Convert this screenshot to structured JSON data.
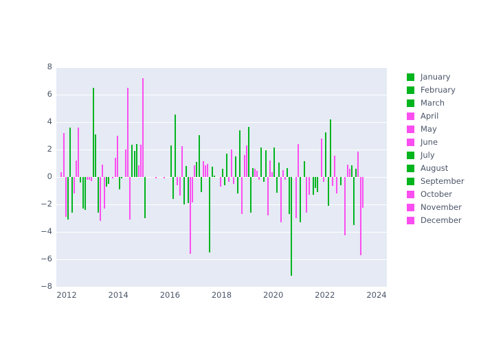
{
  "chart_data": {
    "type": "bar",
    "title": "",
    "subtitle": "",
    "xlabel": "",
    "ylabel": "",
    "xlim": [
      2011.6,
      2024.4
    ],
    "ylim": [
      -8,
      8
    ],
    "grid": true,
    "legend_position": "right",
    "colors": {
      "green": "#00b41e",
      "magenta": "#fb4ef0",
      "plot_background": "#e5eaf4",
      "gridline": "#ffffff",
      "tick_text": "#4a5568",
      "figure_background": "#ffffff"
    },
    "yticks": [
      -8,
      -6,
      -4,
      -2,
      0,
      2,
      4,
      6,
      8
    ],
    "ytick_labels": [
      "−8",
      "−6",
      "−4",
      "−2",
      "0",
      "2",
      "4",
      "6",
      "8"
    ],
    "xticks": [
      2012,
      2014,
      2016,
      2018,
      2020,
      2022,
      2024
    ],
    "xtick_labels": [
      "2012",
      "2014",
      "2016",
      "2018",
      "2020",
      "2022",
      "2024"
    ],
    "legend": [
      {
        "label": "January",
        "color": "#00b41e"
      },
      {
        "label": "February",
        "color": "#00b41e"
      },
      {
        "label": "March",
        "color": "#00b41e"
      },
      {
        "label": "April",
        "color": "#fb4ef0"
      },
      {
        "label": "May",
        "color": "#fb4ef0"
      },
      {
        "label": "June",
        "color": "#fb4ef0"
      },
      {
        "label": "July",
        "color": "#00b41e"
      },
      {
        "label": "August",
        "color": "#00b41e"
      },
      {
        "label": "September",
        "color": "#00b41e"
      },
      {
        "label": "October",
        "color": "#fb4ef0"
      },
      {
        "label": "November",
        "color": "#fb4ef0"
      },
      {
        "label": "December",
        "color": "#fb4ef0"
      }
    ],
    "x": [
      2011.79,
      2011.88,
      2011.96,
      2012.04,
      2012.13,
      2012.21,
      2012.29,
      2012.38,
      2012.46,
      2012.54,
      2012.63,
      2012.71,
      2012.79,
      2012.88,
      2012.96,
      2013.04,
      2013.13,
      2013.21,
      2013.29,
      2013.38,
      2013.46,
      2013.54,
      2013.63,
      2013.71,
      2013.79,
      2013.88,
      2013.96,
      2014.04,
      2014.13,
      2014.21,
      2014.29,
      2014.38,
      2014.46,
      2014.54,
      2014.63,
      2014.71,
      2014.79,
      2014.88,
      2014.96,
      2015.04,
      2015.13,
      2015.21,
      2015.29,
      2015.38,
      2015.46,
      2015.54,
      2015.63,
      2015.71,
      2015.79,
      2015.88,
      2015.96,
      2016.04,
      2016.13,
      2016.21,
      2016.29,
      2016.38,
      2016.46,
      2016.54,
      2016.63,
      2016.71,
      2016.79,
      2016.88,
      2016.96,
      2017.04,
      2017.13,
      2017.21,
      2017.29,
      2017.38,
      2017.46,
      2017.54,
      2017.63,
      2017.71,
      2017.79,
      2017.88,
      2017.96,
      2018.04,
      2018.13,
      2018.21,
      2018.29,
      2018.38,
      2018.46,
      2018.54,
      2018.63,
      2018.71,
      2018.79,
      2018.88,
      2018.96,
      2019.04,
      2019.13,
      2019.21,
      2019.29,
      2019.38,
      2019.46,
      2019.54,
      2019.63,
      2019.71,
      2019.79,
      2019.88,
      2019.96,
      2020.04,
      2020.13,
      2020.21,
      2020.29,
      2020.38,
      2020.46,
      2020.54,
      2020.63,
      2020.71,
      2020.79,
      2020.88,
      2020.96,
      2021.04,
      2021.13,
      2021.21,
      2021.29,
      2021.38,
      2021.46,
      2021.54,
      2021.63,
      2021.71,
      2021.79,
      2021.88,
      2021.96,
      2022.04,
      2022.13,
      2022.21,
      2022.29,
      2022.38,
      2022.46,
      2022.54,
      2022.63,
      2022.71,
      2022.79,
      2022.88,
      2022.96,
      2023.04,
      2023.13,
      2023.21,
      2023.29,
      2023.38,
      2023.46
    ],
    "months": [
      10,
      11,
      12,
      1,
      2,
      3,
      4,
      5,
      6,
      7,
      8,
      9,
      10,
      11,
      12,
      1,
      2,
      3,
      4,
      5,
      6,
      7,
      8,
      9,
      10,
      11,
      12,
      1,
      2,
      3,
      4,
      5,
      6,
      7,
      8,
      9,
      10,
      11,
      12,
      1,
      2,
      3,
      4,
      5,
      6,
      7,
      8,
      9,
      10,
      11,
      12,
      1,
      2,
      3,
      4,
      5,
      6,
      7,
      8,
      9,
      10,
      11,
      12,
      1,
      2,
      3,
      4,
      5,
      6,
      7,
      8,
      9,
      10,
      11,
      12,
      1,
      2,
      3,
      4,
      5,
      6,
      7,
      8,
      9,
      10,
      11,
      12,
      1,
      2,
      3,
      4,
      5,
      6,
      7,
      8,
      9,
      10,
      11,
      12,
      1,
      2,
      3,
      4,
      5,
      6,
      7,
      8,
      9,
      10,
      11,
      12,
      1,
      2,
      3,
      4,
      5,
      6,
      7,
      8,
      9,
      10,
      11,
      12,
      1,
      2,
      3,
      4,
      5,
      6,
      7,
      8,
      9,
      10,
      11,
      12,
      1,
      2,
      3,
      4,
      5
    ],
    "values": [
      0.35,
      3.2,
      -2.9,
      -3.1,
      3.6,
      -2.6,
      -1.2,
      1.2,
      3.6,
      -0.4,
      -2.3,
      -2.4,
      -0.2,
      -0.2,
      -0.3,
      6.5,
      3.1,
      -2.6,
      -3.2,
      0.9,
      -2.3,
      -0.7,
      -0.5,
      0.0,
      -0.1,
      1.4,
      3.0,
      -0.9,
      -0.1,
      0.0,
      2.0,
      6.5,
      -3.1,
      2.35,
      1.9,
      2.4,
      0.85,
      2.35,
      7.2,
      -3.0,
      0.0,
      0.0,
      0.0,
      0.0,
      -0.1,
      0.0,
      0.0,
      0.0,
      -0.1,
      0.0,
      0.0,
      2.3,
      -1.6,
      4.55,
      -0.6,
      -1.35,
      2.25,
      -2.0,
      0.8,
      -1.9,
      -5.6,
      -1.85,
      0.85,
      1.1,
      3.05,
      -1.1,
      1.15,
      0.85,
      0.95,
      -5.5,
      0.75,
      0.1,
      0.0,
      0.0,
      -0.7,
      0.6,
      -0.6,
      1.7,
      -0.35,
      2.0,
      -0.5,
      1.5,
      -1.2,
      3.4,
      -2.7,
      1.6,
      2.3,
      3.65,
      -2.6,
      0.65,
      0.6,
      0.45,
      -0.2,
      2.15,
      -0.35,
      1.95,
      -2.8,
      1.2,
      0.35,
      2.15,
      -1.15,
      1.05,
      -3.3,
      0.5,
      -0.2,
      0.65,
      -2.7,
      -7.2,
      0.0,
      -3.0,
      2.4,
      -3.3,
      0.0,
      1.15,
      -2.6,
      -1.3,
      0.0,
      -1.3,
      -0.8,
      -1.1,
      0.0,
      2.8,
      -0.35,
      3.25,
      -2.1,
      4.2,
      -0.65,
      1.55,
      -1.2,
      0.0,
      -0.6,
      0.0,
      -4.25,
      0.9,
      0.6,
      0.85,
      -3.5,
      0.6,
      1.85,
      -5.7,
      -2.25
    ]
  }
}
